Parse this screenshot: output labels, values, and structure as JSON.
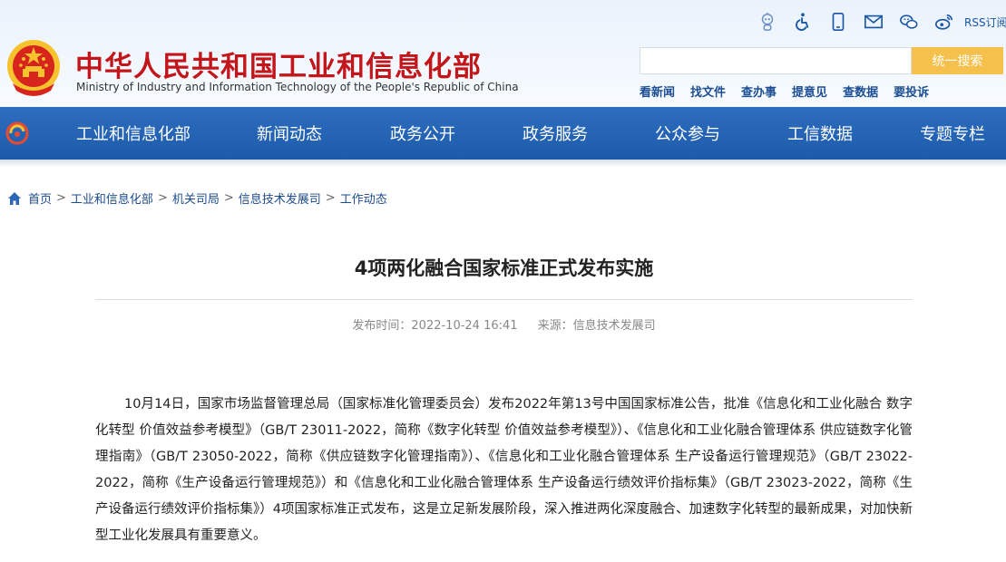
{
  "header": {
    "site_title_cn": "中华人民共和国工业和信息化部",
    "site_title_en": "Ministry of Industry and Information Technology of the People's Republic of China",
    "top_icons": [
      "robot-assistant-icon",
      "accessibility-icon",
      "mobile-icon",
      "mail-icon",
      "wechat-icon",
      "weibo-icon"
    ],
    "rss_label": "RSS订阅",
    "search_placeholder": "",
    "search_button": "统一搜索",
    "quick_links": [
      "看新闻",
      "找文件",
      "查办事",
      "提意见",
      "查数据",
      "要投诉"
    ]
  },
  "nav": {
    "items": [
      "工业和信息化部",
      "新闻动态",
      "政务公开",
      "政务服务",
      "公众参与",
      "工信数据",
      "专题专栏"
    ]
  },
  "breadcrumb": {
    "items": [
      "首页",
      "工业和信息化部",
      "机关司局",
      "信息技术发展司",
      "工作动态"
    ],
    "separator": ">"
  },
  "article": {
    "title": "4项两化融合国家标准正式发布实施",
    "publish_label": "发布时间：",
    "publish_time": "2022-10-24 16:41",
    "source_label": "来源：",
    "source": "信息技术发展司",
    "body": "10月14日，国家市场监督管理总局（国家标准化管理委员会）发布2022年第13号中国国家标准公告，批准《信息化和工业化融合 数字化转型 价值效益参考模型》（GB/T  23011-2022，简称《数字化转型 价值效益参考模型》）、《信息化和工业化融合管理体系 供应链数字化管理指南》（GB/T  23050-2022，简称《供应链数字化管理指南》）、《信息化和工业化融合管理体系  生产设备运行管理规范》（GB/T 23022-2022，简称《生产设备运行管理规范》）和《信息化和工业化融合管理体系  生产设备运行绩效评价指标集》（GB/T 23023-2022，简称《生产设备运行绩效评价指标集》）4项国家标准正式发布，这是立足新发展阶段，深入推进两化深度融合、加速数字化转型的最新成果，对加快新型工业化发展具有重要意义。"
  },
  "colors": {
    "brand_red": "#c2161b",
    "nav_blue": "#1d5aaa",
    "search_button": "#f5c04b",
    "link_blue": "#1d4b8f"
  }
}
